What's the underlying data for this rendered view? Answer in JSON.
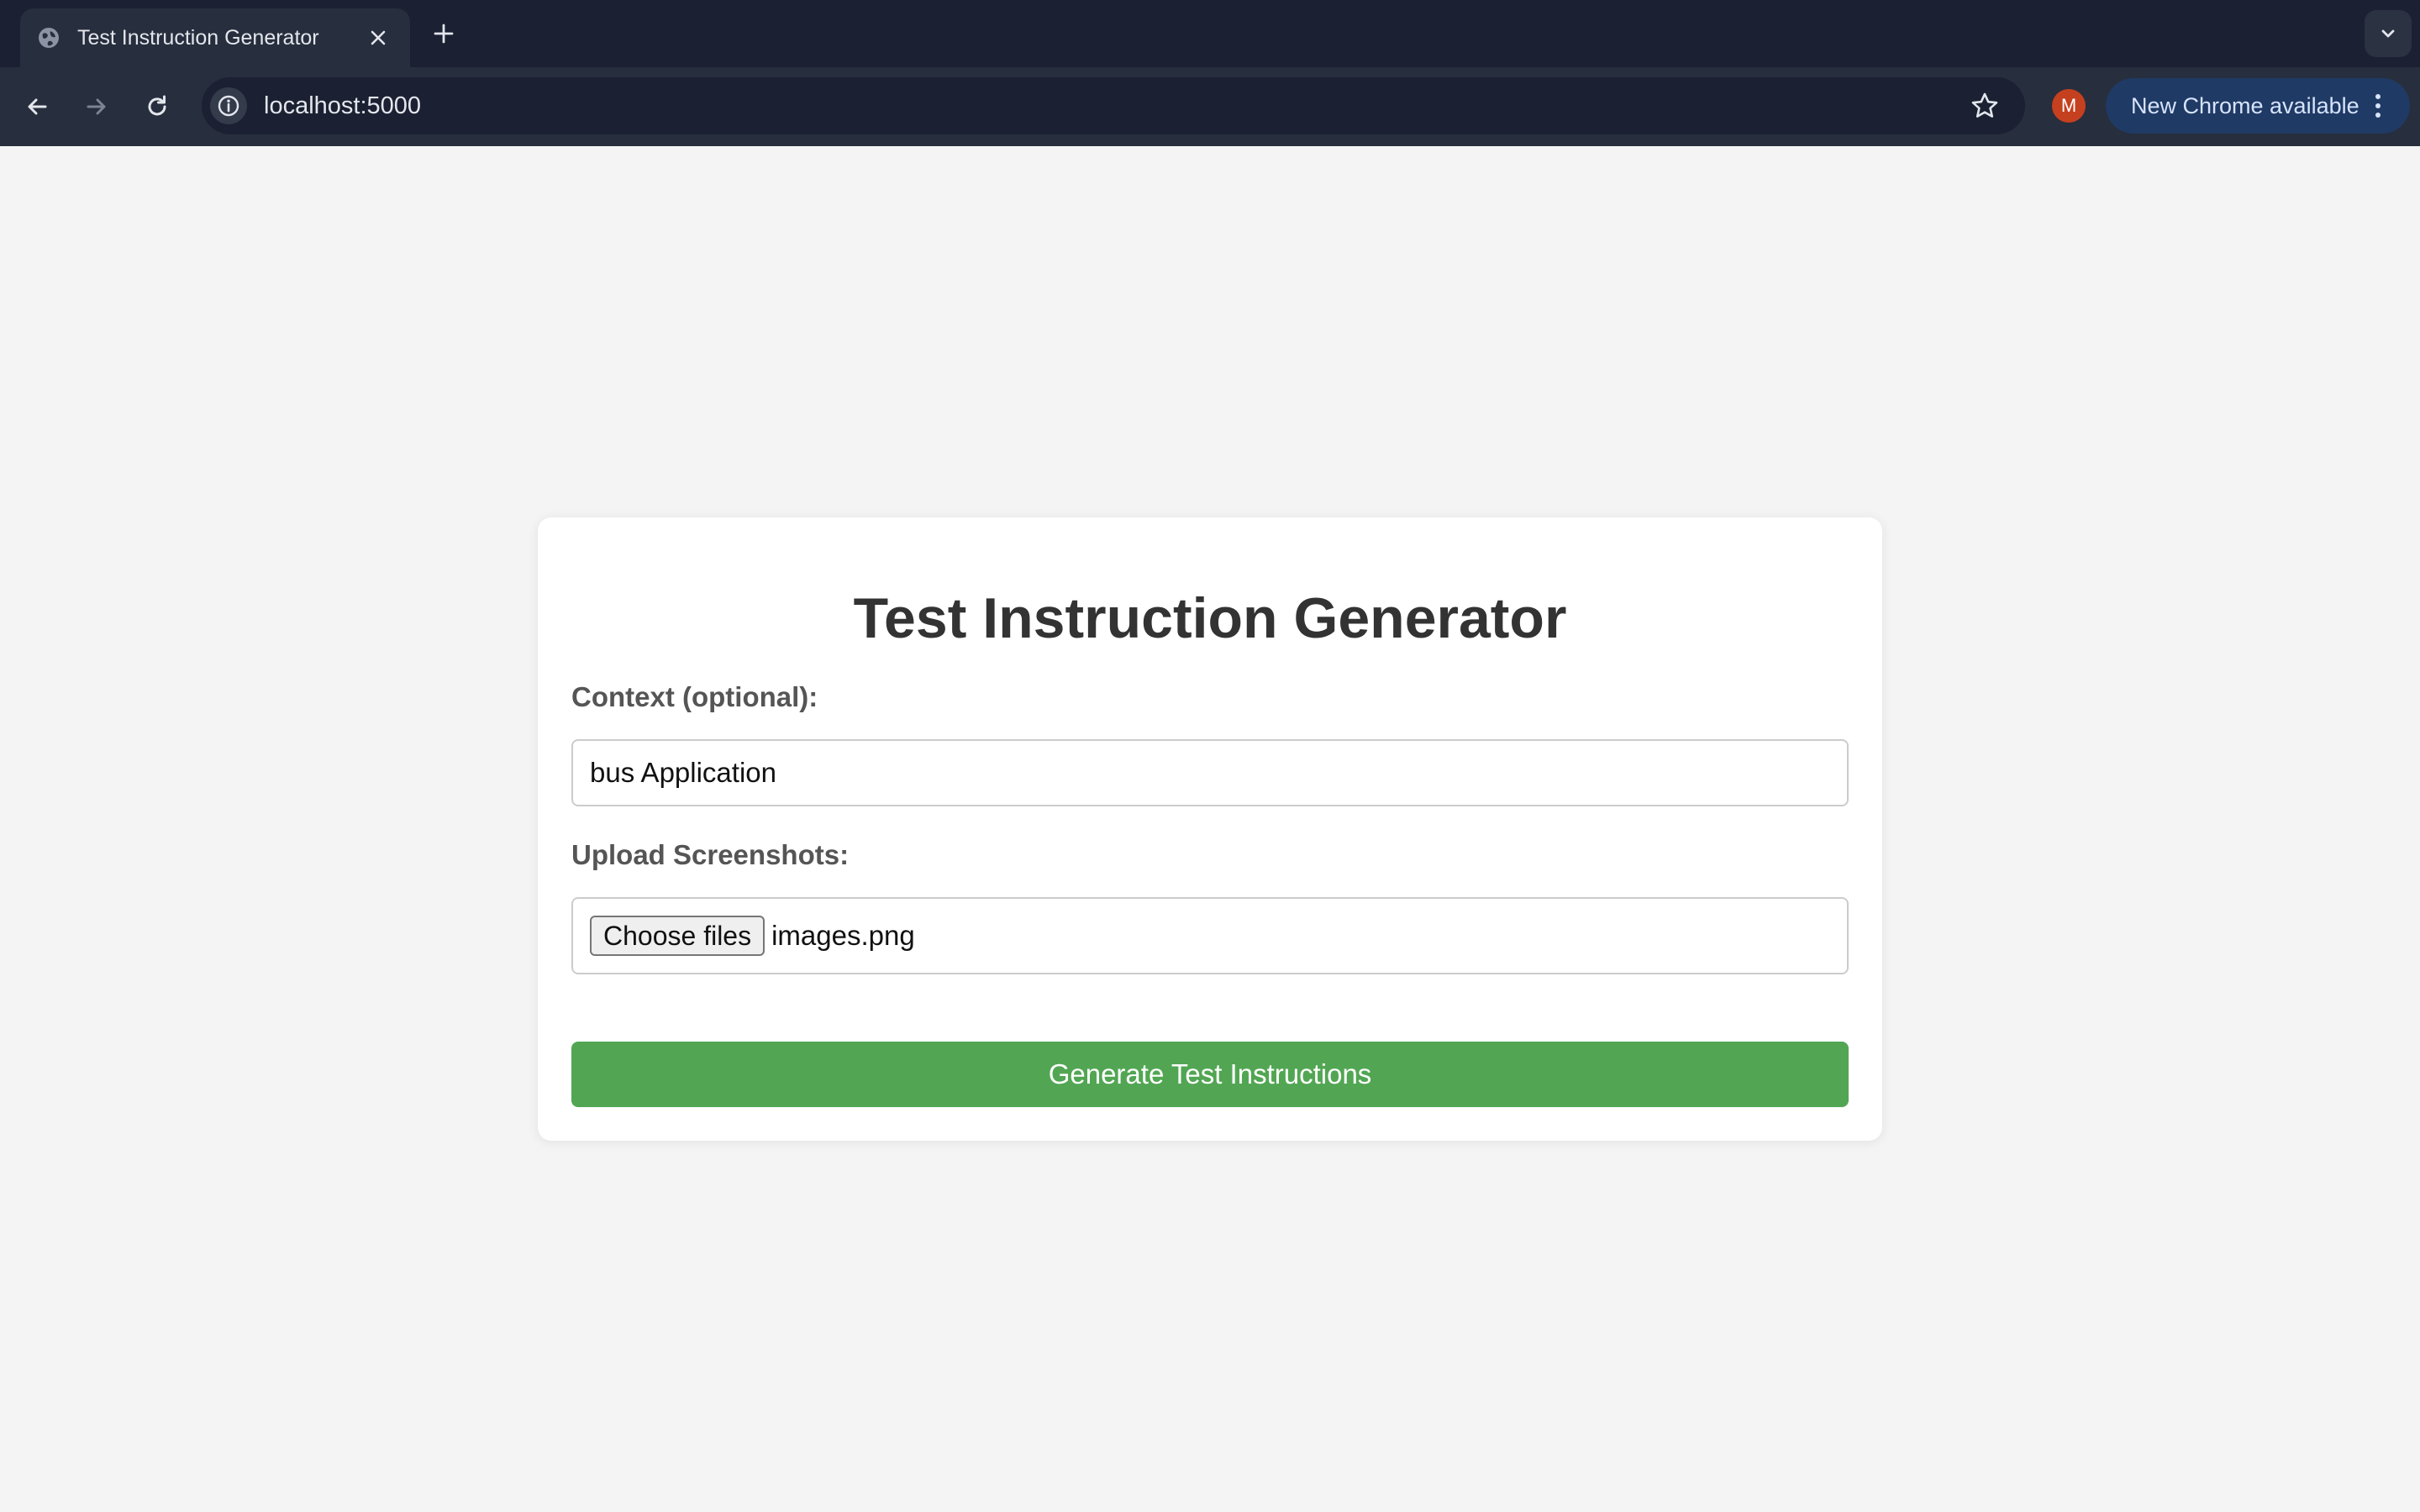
{
  "browser": {
    "tab_title": "Test Instruction Generator",
    "url": "localhost:5000",
    "profile_initial": "M",
    "update_label": "New Chrome available"
  },
  "icons": {
    "favicon": "globe-icon",
    "tab_close": "close-icon",
    "new_tab": "plus-icon",
    "tab_search": "chevron-down-icon",
    "back": "arrow-left-icon",
    "forward": "arrow-right-icon",
    "reload": "reload-icon",
    "site_info": "info-icon",
    "bookmark": "star-icon",
    "menu": "more-vertical-icon"
  },
  "colors": {
    "accent_button": "#52a653",
    "profile_avatar": "#c5401f",
    "update_pill": "#1f3a64"
  },
  "page": {
    "title": "Test Instruction Generator",
    "context_label": "Context (optional):",
    "context_value": "bus Application",
    "upload_label": "Upload Screenshots:",
    "choose_files_label": "Choose files",
    "selected_file": "images.png",
    "generate_label": "Generate Test Instructions"
  }
}
